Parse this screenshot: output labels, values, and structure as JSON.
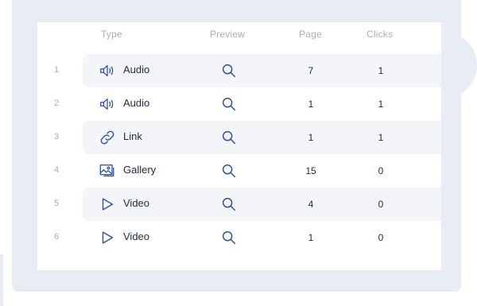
{
  "colors": {
    "frame": "#e8ecf4",
    "row_background": "#f4f5f8",
    "icon_blue": "#2f4f9e",
    "header_text": "#a3aec2",
    "body_text": "#1e2a3c"
  },
  "table": {
    "columns": [
      "Type",
      "Preview",
      "Page",
      "Clicks"
    ],
    "rows": [
      {
        "index": "1",
        "type": "Audio",
        "icon": "speaker-icon",
        "page": "7",
        "clicks": "1",
        "highlighted": true
      },
      {
        "index": "2",
        "type": "Audio",
        "icon": "speaker-icon",
        "page": "1",
        "clicks": "1",
        "highlighted": false
      },
      {
        "index": "3",
        "type": "Link",
        "icon": "link-icon",
        "page": "1",
        "clicks": "1",
        "highlighted": true
      },
      {
        "index": "4",
        "type": "Gallery",
        "icon": "gallery-icon",
        "page": "15",
        "clicks": "0",
        "highlighted": false
      },
      {
        "index": "5",
        "type": "Video",
        "icon": "play-icon",
        "page": "4",
        "clicks": "0",
        "highlighted": true
      },
      {
        "index": "6",
        "type": "Video",
        "icon": "play-icon",
        "page": "1",
        "clicks": "0",
        "highlighted": false
      }
    ]
  }
}
